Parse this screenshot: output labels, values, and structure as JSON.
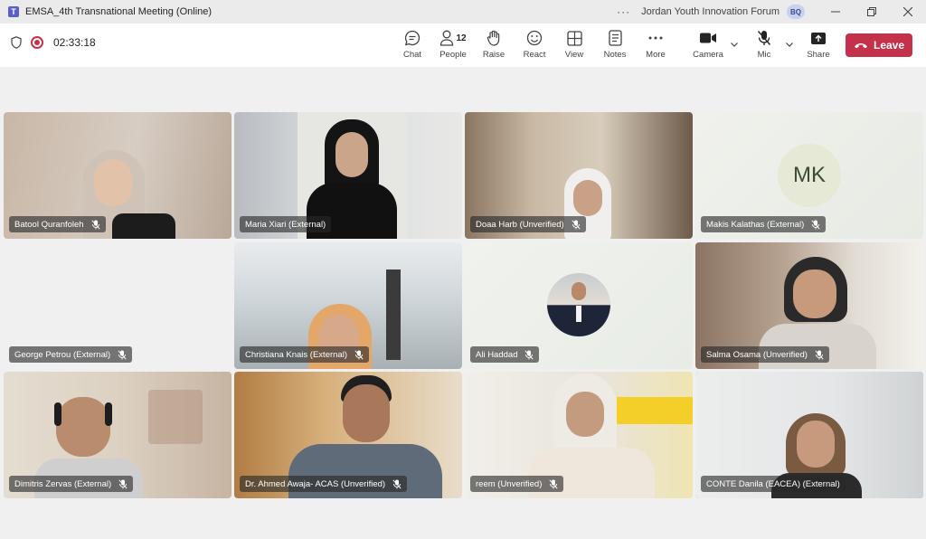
{
  "window": {
    "title": "EMSA_4th Transnational Meeting (Online)",
    "more_dots": "···",
    "org_name": "Jordan Youth Innovation Forum",
    "org_initials": "BQ",
    "app_icon_letter": "T"
  },
  "toolbar": {
    "timer": "02:33:18",
    "people_count": "12",
    "buttons": [
      {
        "label": "Chat",
        "icon": "chat-icon"
      },
      {
        "label": "People",
        "icon": "people-icon"
      },
      {
        "label": "Raise",
        "icon": "raise-hand-icon"
      },
      {
        "label": "React",
        "icon": "react-smiley-icon"
      },
      {
        "label": "View",
        "icon": "view-grid-icon"
      },
      {
        "label": "Notes",
        "icon": "notes-icon"
      },
      {
        "label": "More",
        "icon": "more-icon"
      },
      {
        "label": "Camera",
        "icon": "camera-icon"
      },
      {
        "label": "Mic",
        "icon": "mic-muted-icon"
      },
      {
        "label": "Share",
        "icon": "share-icon"
      }
    ],
    "leave_label": "Leave"
  },
  "participants": [
    {
      "name": "Batool Quranfoleh",
      "muted": true
    },
    {
      "name": "Maria Xiari (External)",
      "muted": false
    },
    {
      "name": "Doaa Harb (Unverified)",
      "muted": true
    },
    {
      "name": "Makis Kalathas (External)",
      "muted": true,
      "initials": "MK"
    },
    {
      "name": "George Petrou (External)",
      "muted": true
    },
    {
      "name": "Christiana Knais (External)",
      "muted": true
    },
    {
      "name": "Ali Haddad",
      "muted": true
    },
    {
      "name": "Salma Osama (Unverified)",
      "muted": true
    },
    {
      "name": "Dimitris Zervas (External)",
      "muted": true
    },
    {
      "name": "Dr. Ahmed Awaja- ACAS (Unverified)",
      "muted": true
    },
    {
      "name": "reem (Unverified)",
      "muted": true
    },
    {
      "name": "CONTE Danila (EACEA) (External)",
      "muted": false,
      "active_speaker": true
    }
  ],
  "colors": {
    "accent": "#5b5fc7",
    "leave": "#c4314b",
    "background": "#f0f0f0"
  }
}
